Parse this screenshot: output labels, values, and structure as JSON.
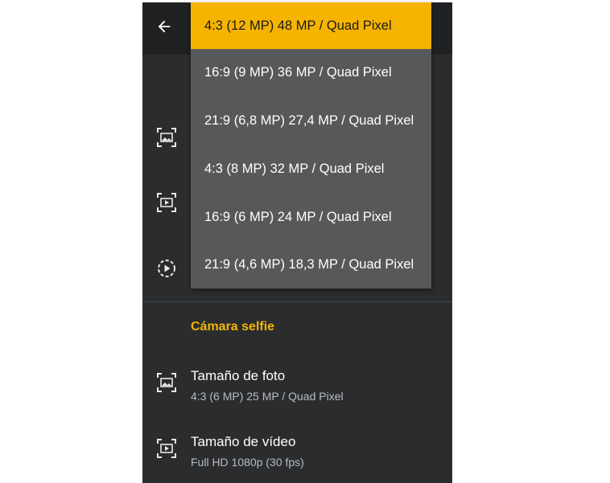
{
  "camera_settings": {
    "back_icon": "arrow-left-icon",
    "side_icons": [
      "photo-size-icon",
      "video-size-icon",
      "video-playback-icon"
    ]
  },
  "resolution_menu": {
    "items": [
      {
        "label": "4:3 (12 MP) 48 MP / Quad Pixel",
        "selected": true
      },
      {
        "label": "16:9 (9 MP) 36 MP / Quad Pixel",
        "selected": false
      },
      {
        "label": "21:9 (6,8 MP) 27,4 MP / Quad Pixel",
        "selected": false
      },
      {
        "label": "4:3 (8 MP) 32 MP / Quad Pixel",
        "selected": false
      },
      {
        "label": "16:9 (6 MP) 24 MP / Quad Pixel",
        "selected": false
      },
      {
        "label": "21:9 (4,6 MP) 18,3 MP / Quad Pixel",
        "selected": false
      }
    ],
    "selected_color": "#f6b400"
  },
  "selfie_section": {
    "title": "Cámara selfie",
    "title_color": "#f5b400",
    "photo_size": {
      "title": "Tamaño de foto",
      "value": "4:3 (6 MP) 25 MP / Quad Pixel",
      "icon": "photo-size-icon"
    },
    "video_size": {
      "title": "Tamaño de vídeo",
      "value": "Full HD 1080p (30 fps)",
      "icon": "video-size-icon"
    }
  }
}
